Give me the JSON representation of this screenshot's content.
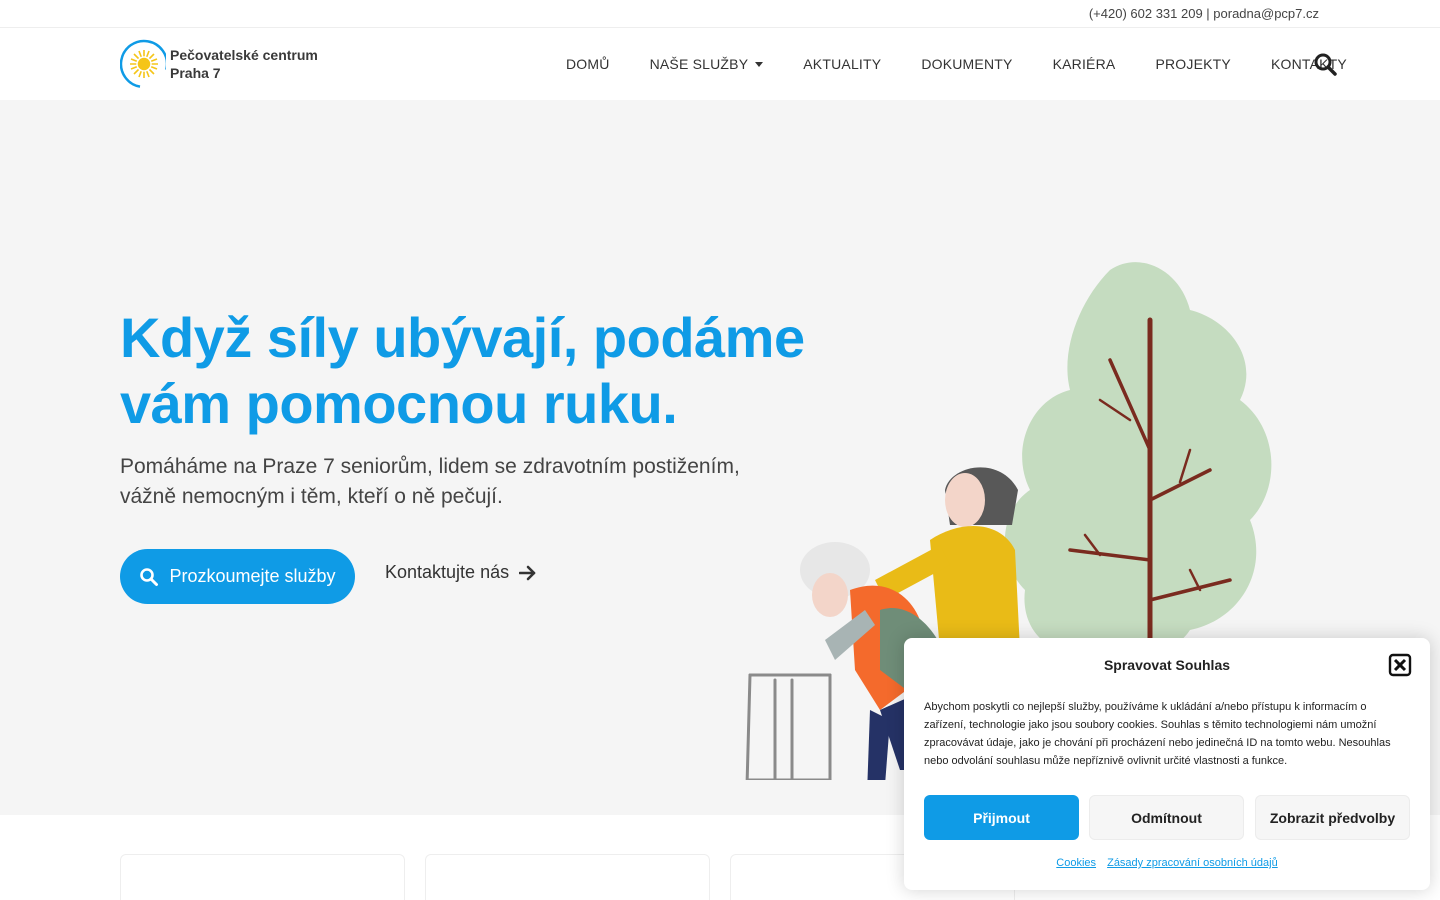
{
  "topbar": {
    "contact": "(+420) 602 331 209 | poradna@pcp7.cz"
  },
  "logo": {
    "line1": "Pečovatelské centrum",
    "line2": "Praha 7"
  },
  "nav": {
    "items": [
      "DOMŮ",
      "NAŠE SLUŽBY",
      "AKTUALITY",
      "DOKUMENTY",
      "KARIÉRA",
      "PROJEKTY",
      "KONTAKTY"
    ]
  },
  "hero": {
    "title": "Když síly ubývají, podáme vám pomocnou ruku.",
    "subtitle": "Pomáháme na Praze 7 seniorům, lidem se zdravotním postižením, vážně nemocným i těm, kteří o ně pečují.",
    "primary_button": "Prozkoumejte služby",
    "secondary_link": "Kontaktujte nás"
  },
  "cookie": {
    "title": "Spravovat Souhlas",
    "text": "Abychom poskytli co nejlepší služby, používáme k ukládání a/nebo přístupu k informacím o zařízení, technologie jako jsou soubory cookies. Souhlas s těmito technologiemi nám umožní zpracovávat údaje, jako je chování při procházení nebo jedinečná ID na tomto webu. Nesouhlas nebo odvolání souhlasu může nepříznivě ovlivnit určité vlastnosti a funkce.",
    "accept": "Přijmout",
    "deny": "Odmítnout",
    "preferences": "Zobrazit předvolby",
    "link_cookies": "Cookies",
    "link_privacy": "Zásady zpracování osobních údajů"
  },
  "colors": {
    "accent": "#0f9be6",
    "hero_bg": "#f5f5f5"
  }
}
